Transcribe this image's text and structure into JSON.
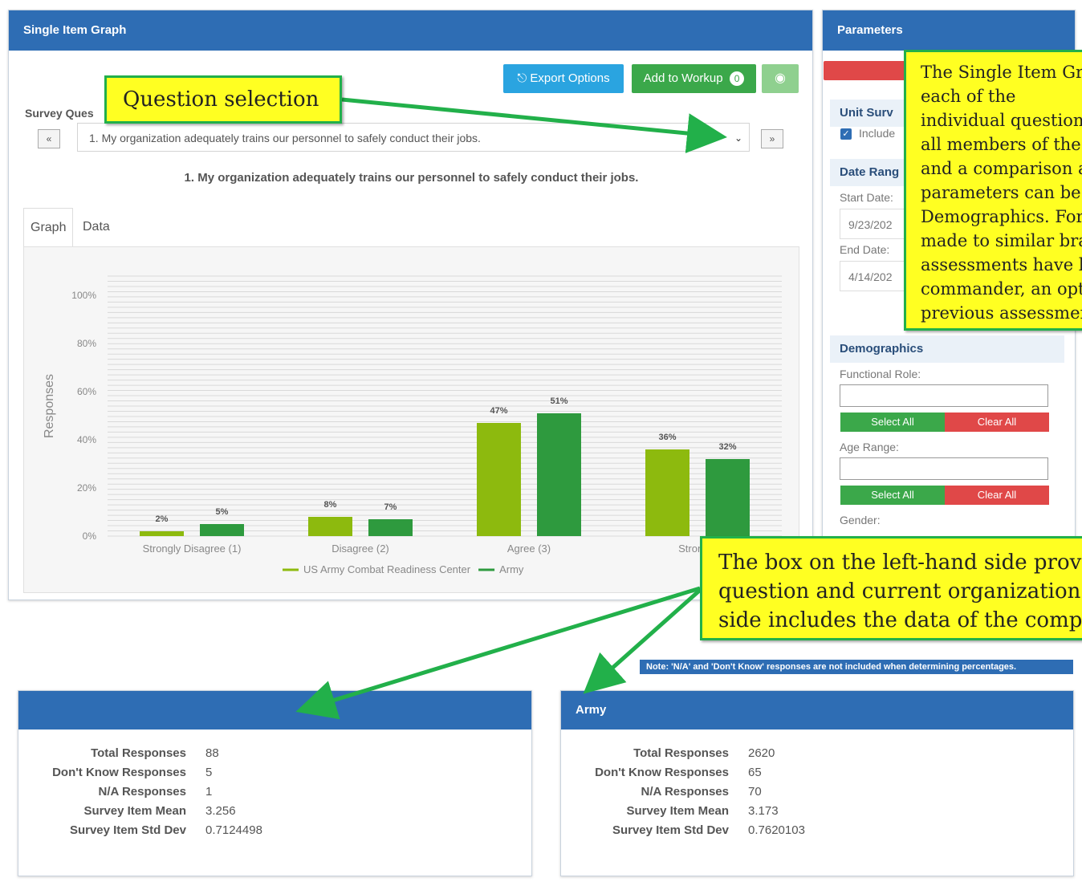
{
  "graph_panel": {
    "title": "Single Item Graph",
    "export_label": "Export Options",
    "workup_label": "Add to Workup",
    "workup_count": "0",
    "survey_question_label": "Survey Ques",
    "prev_btn": "«",
    "next_btn": "»",
    "selected_question": "1. My organization adequately trains our personnel to safely conduct their jobs.",
    "question_title": "1. My organization adequately trains our personnel to safely conduct their jobs.",
    "tabs": [
      {
        "label": "Graph"
      },
      {
        "label": "Data"
      }
    ]
  },
  "chart_data": {
    "type": "bar",
    "categories": [
      "Strongly Disagree (1)",
      "Disagree (2)",
      "Agree (3)",
      "Strongly"
    ],
    "series": [
      {
        "name": "US Army Combat Readiness Center",
        "values": [
          2,
          8,
          47,
          36
        ],
        "color": "#8dba0e"
      },
      {
        "name": "Army",
        "values": [
          5,
          7,
          51,
          32
        ],
        "color": "#2e9a3e"
      }
    ],
    "ylabel": "Responses",
    "ylim": [
      0,
      100
    ],
    "yticks": [
      "0%",
      "20%",
      "40%",
      "60%",
      "80%",
      "100%"
    ],
    "grid": true,
    "legend": "bottom"
  },
  "params_panel": {
    "title": "Parameters",
    "unit_surveys_label": "Unit Surv",
    "include_label": "Include",
    "date_range_label": "Date Rang",
    "start_date_label": "Start Date:",
    "start_date": "9/23/202",
    "end_date_label": "End Date:",
    "end_date": "4/14/202",
    "demographics_label": "Demographics",
    "functional_role_label": "Functional Role:",
    "age_range_label": "Age Range:",
    "gender_label": "Gender:",
    "select_all": "Select All",
    "clear_all": "Clear All"
  },
  "note": "Note: 'N/A' and 'Don't Know' responses are not included when determining percentages.",
  "left_stats": {
    "title": "",
    "rows": [
      {
        "label": "Total Responses",
        "value": "88"
      },
      {
        "label": "Don't Know Responses",
        "value": "5"
      },
      {
        "label": "N/A Responses",
        "value": "1"
      },
      {
        "label": "Survey Item Mean",
        "value": "3.256"
      },
      {
        "label": "Survey Item Std Dev",
        "value": "0.7124498"
      }
    ]
  },
  "right_stats": {
    "title": "Army",
    "rows": [
      {
        "label": "Total Responses",
        "value": "2620"
      },
      {
        "label": "Don't Know Responses",
        "value": "65"
      },
      {
        "label": "N/A Responses",
        "value": "70"
      },
      {
        "label": "Survey Item Mean",
        "value": "3.173"
      },
      {
        "label": "Survey Item Std Dev",
        "value": "0.7620103"
      }
    ]
  },
  "callouts": {
    "question_selection": "Question selection",
    "right_lines": [
      "The Single Item Gra",
      "each of the",
      "individual question",
      "all members of the",
      "and a comparison a",
      "parameters can be",
      "Demographics. For",
      "made to similar bra",
      "assessments have b",
      "commander, an opt",
      "previous assessmen"
    ],
    "bottom_lines": [
      "The box on the left-hand side provid",
      "question and current organization.",
      "side includes the data of the compar"
    ]
  }
}
